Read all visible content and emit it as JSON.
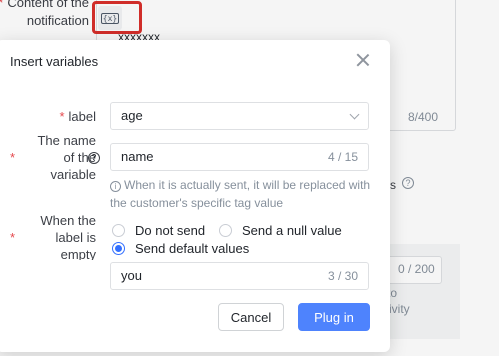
{
  "background": {
    "content_label": "Content of the notification",
    "content_value": "xxxxxxx",
    "content_count": "8/400",
    "fragment_right": "rs",
    "field_count": "0 / 200",
    "fragment_lines": "er to\nactivity"
  },
  "dialog": {
    "title": "Insert variables",
    "label_field": {
      "label": "label",
      "value": "age"
    },
    "name_field": {
      "label": "The name of the variable",
      "value": "name",
      "count": "4 / 15"
    },
    "hint": "When it is actually sent, it will be replaced with the customer's specific tag value",
    "empty_field": {
      "label": "When the label is empty",
      "options": [
        "Do not send",
        "Send a null value",
        "Send default values"
      ],
      "selected": "Send default values",
      "default_value": "you",
      "default_count": "3 / 30"
    },
    "cancel_label": "Cancel",
    "confirm_label": "Plug in"
  },
  "colors": {
    "accent": "#4e83fd",
    "required": "#e5484d",
    "highlight": "#d92f2b"
  },
  "icons": [
    "variable-icon",
    "close-icon",
    "help-icon",
    "info-icon",
    "chevron-down-icon"
  ]
}
